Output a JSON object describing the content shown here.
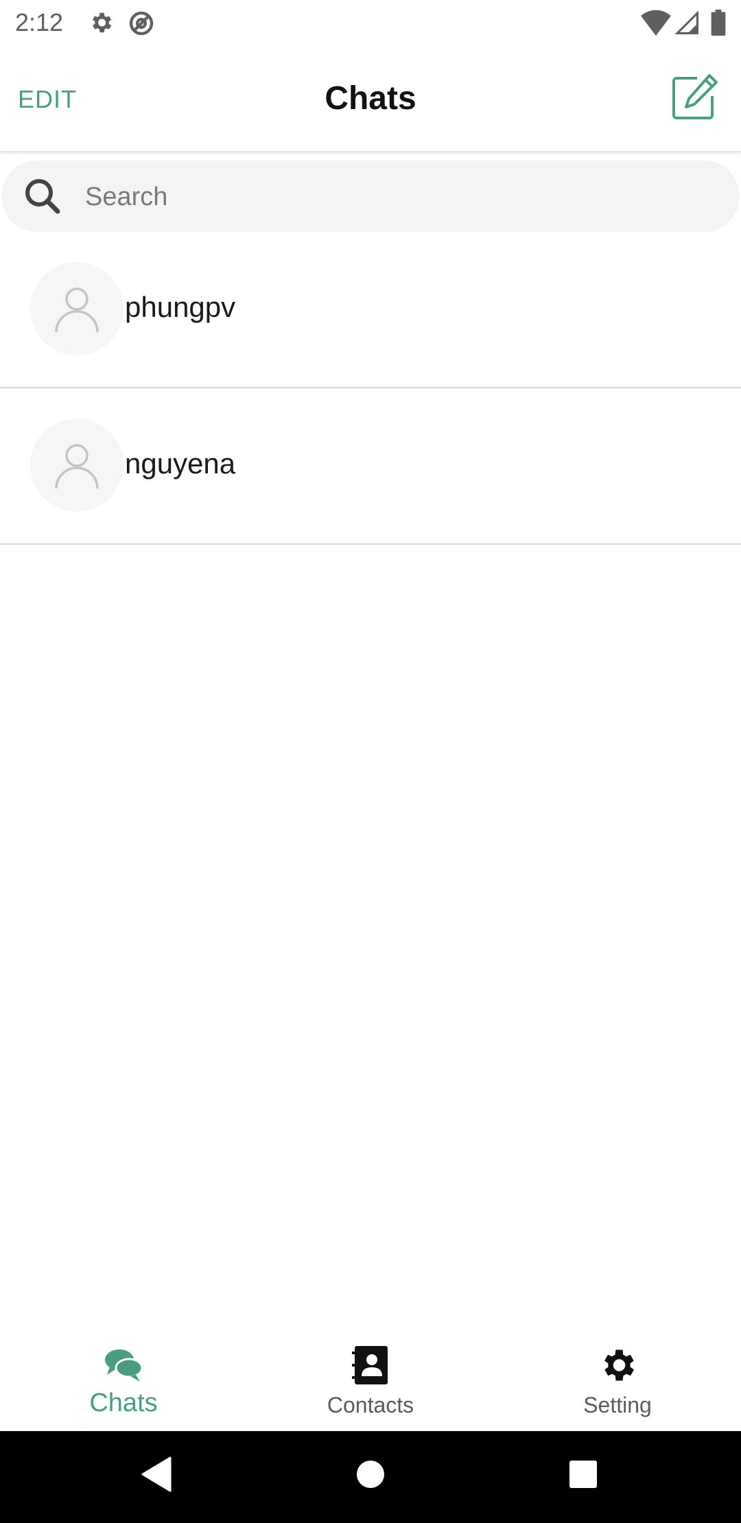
{
  "status_bar": {
    "time": "2:12",
    "icons": [
      "gear-icon",
      "at-sign-icon",
      "wifi-icon",
      "signal-icon",
      "battery-icon"
    ]
  },
  "header": {
    "edit_label": "EDIT",
    "title": "Chats",
    "compose_icon": "compose-icon"
  },
  "search": {
    "placeholder": "Search",
    "value": ""
  },
  "chats": [
    {
      "name": "phungpv"
    },
    {
      "name": "nguyena"
    }
  ],
  "tabbar": {
    "tabs": [
      {
        "label": "Chats",
        "icon": "chat-bubbles-icon",
        "active": true
      },
      {
        "label": "Contacts",
        "icon": "contacts-book-icon",
        "active": false
      },
      {
        "label": "Setting",
        "icon": "gear-icon",
        "active": false
      }
    ]
  },
  "colors": {
    "accent": "#4a9e7f",
    "search_bg": "#f4f4f4",
    "divider": "#d8d8d8",
    "nav_bar": "#000000"
  }
}
